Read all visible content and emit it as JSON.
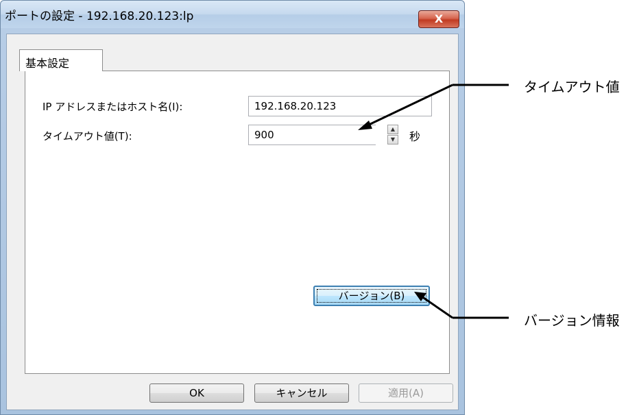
{
  "window": {
    "title": "ポートの設定 - 192.168.20.123:lp",
    "close_label": "X"
  },
  "tabs": [
    {
      "label": "基本設定",
      "selected": true
    }
  ],
  "form": {
    "host_label": "IP アドレスまたはホスト名(I):",
    "host_value": "192.168.20.123",
    "timeout_label": "タイムアウト値(T):",
    "timeout_value": "900",
    "timeout_unit": "秒"
  },
  "buttons": {
    "version": "バージョン(B)",
    "ok": "OK",
    "cancel": "キャンセル",
    "apply": "適用(A)"
  },
  "annotations": {
    "timeout": "タイムアウト値",
    "version": "バージョン情報"
  }
}
